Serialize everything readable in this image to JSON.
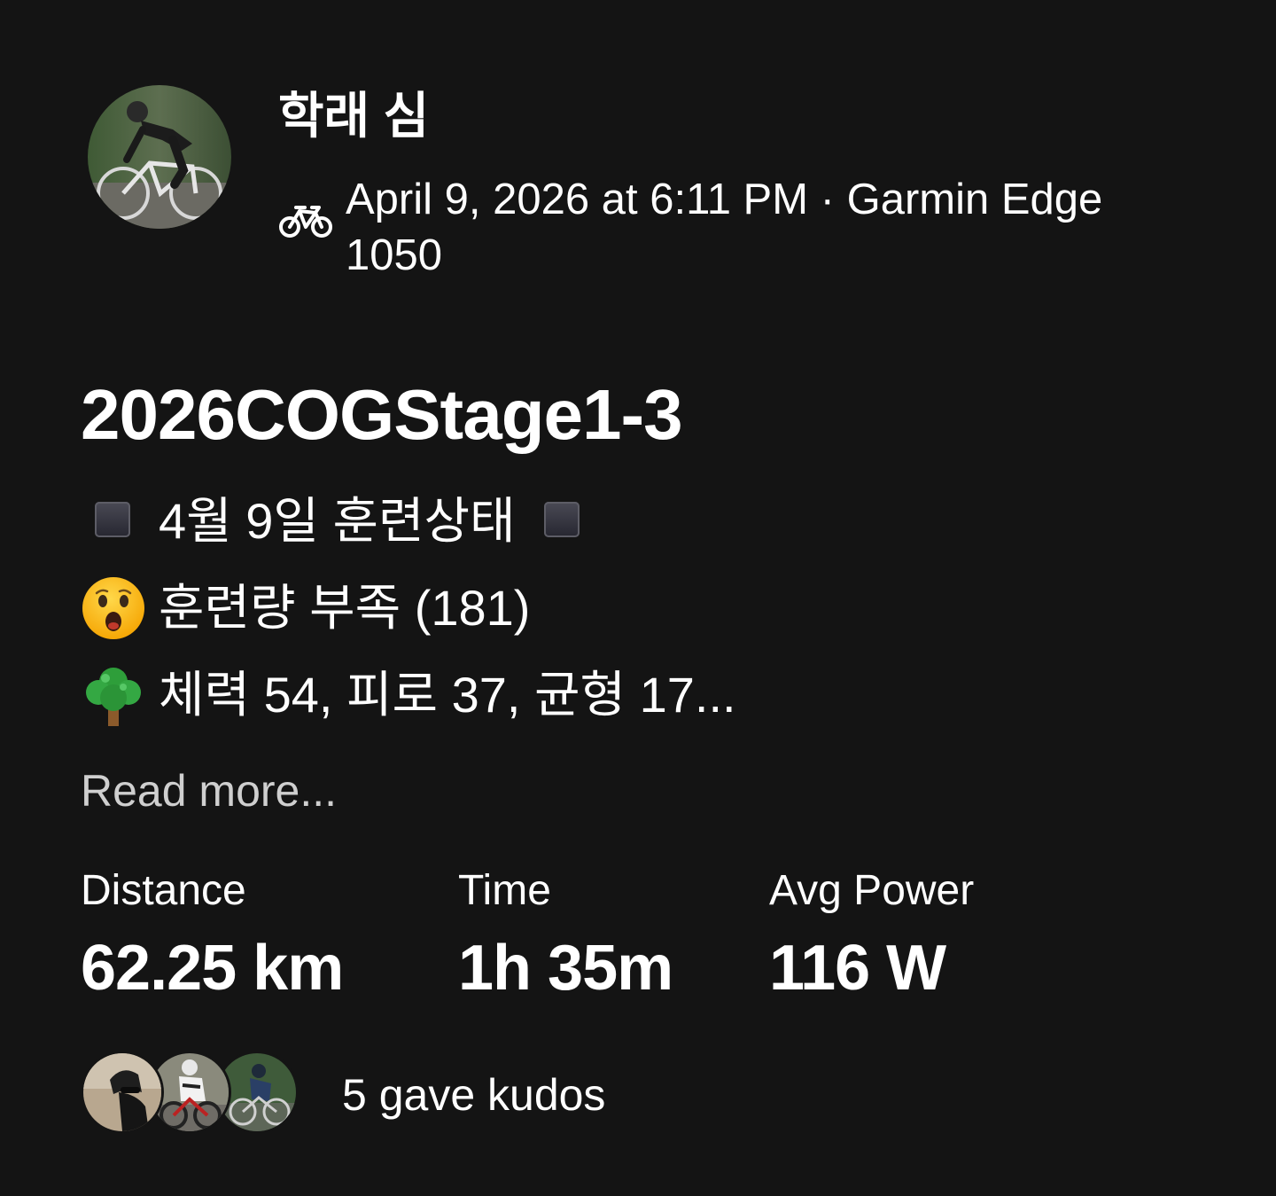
{
  "athlete": {
    "name": "학래 심"
  },
  "activity": {
    "type_icon": "bike-icon",
    "meta": "April 9, 2026 at 6:11 PM · Garmin Edge 1050",
    "title": "2026COGStage1-3",
    "description": {
      "line1_text": "4월 9일 훈련상태",
      "line1_icon": "black-square-icon",
      "line2_emoji": "astonished-face-icon",
      "line2_text": "훈련량 부족 (181)",
      "line3_emoji": "tree-icon",
      "line3_text": "체력 54, 피로 37, 균형 17..."
    },
    "read_more": "Read more..."
  },
  "stats": [
    {
      "label": "Distance",
      "value": "62.25 km"
    },
    {
      "label": "Time",
      "value": "1h 35m"
    },
    {
      "label": "Avg Power",
      "value": "116 W"
    }
  ],
  "kudos": {
    "text": "5 gave kudos",
    "avatar_count_shown": 3
  },
  "colors": {
    "background": "#141414",
    "text": "#ffffff",
    "muted_text": "#cfcfcf"
  }
}
